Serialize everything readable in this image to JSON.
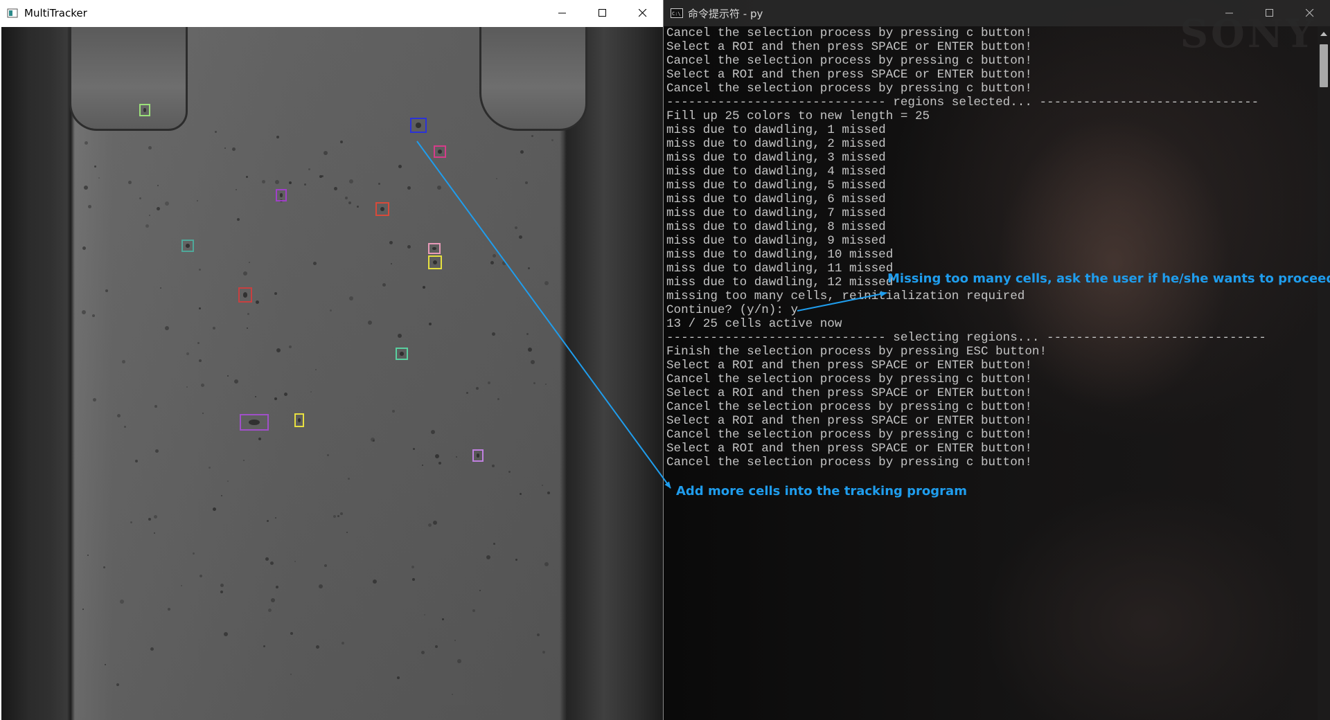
{
  "tracker_window": {
    "title": "MultiTracker",
    "roi_colors": [
      "#9be07a",
      "#2b32d8",
      "#d63c8a",
      "#a040c8",
      "#d84a3a",
      "#4fa89a",
      "#e89ab8",
      "#e6e040",
      "#c84040",
      "#5ad0a0",
      "#a050c8",
      "#e8e040",
      "#c080e0"
    ]
  },
  "console_window": {
    "title": "命令提示符 - py",
    "watermark": "SONY",
    "lines": [
      "Cancel the selection process by pressing c button!",
      "Select a ROI and then press SPACE or ENTER button!",
      "Cancel the selection process by pressing c button!",
      "Select a ROI and then press SPACE or ENTER button!",
      "Cancel the selection process by pressing c button!",
      "------------------------------ regions selected... ------------------------------",
      "Fill up 25 colors to new length = 25",
      "miss due to dawdling, 1 missed",
      "miss due to dawdling, 2 missed",
      "miss due to dawdling, 3 missed",
      "miss due to dawdling, 4 missed",
      "miss due to dawdling, 5 missed",
      "miss due to dawdling, 6 missed",
      "miss due to dawdling, 7 missed",
      "miss due to dawdling, 8 missed",
      "miss due to dawdling, 9 missed",
      "miss due to dawdling, 10 missed",
      "miss due to dawdling, 11 missed",
      "miss due to dawdling, 12 missed",
      "missing too many cells, reinitialization required",
      "Continue? (y/n): y",
      "13 / 25 cells active now",
      "------------------------------ selecting regions... ------------------------------",
      "Finish the selection process by pressing ESC button!",
      "Select a ROI and then press SPACE or ENTER button!",
      "Cancel the selection process by pressing c button!",
      "Select a ROI and then press SPACE or ENTER button!",
      "Cancel the selection process by pressing c button!",
      "Select a ROI and then press SPACE or ENTER button!",
      "Cancel the selection process by pressing c button!",
      "Select a ROI and then press SPACE or ENTER button!",
      "Cancel the selection process by pressing c button!"
    ]
  },
  "annotations": {
    "missing": "Missing too many cells, ask the user if he/she wants to proceed",
    "add": "Add more cells into the tracking program",
    "color": "#1f9ded"
  }
}
